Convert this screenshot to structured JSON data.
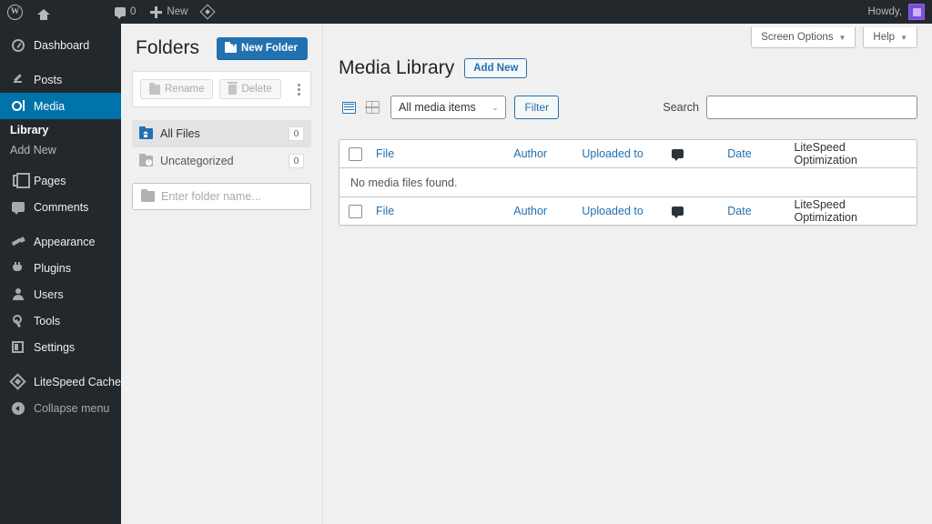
{
  "adminbar": {
    "wp_logo": "wordpress-logo",
    "site_home": "site-home",
    "comments_count": "0",
    "new_label": "New",
    "litespeed": "litespeed-icon",
    "howdy": "Howdy,"
  },
  "sidebar": {
    "items": [
      {
        "label": "Dashboard",
        "icon": "dashboard-icon",
        "active": false
      },
      {
        "label": "Posts",
        "icon": "posts-pin-icon",
        "active": false
      },
      {
        "label": "Media",
        "icon": "media-icon",
        "active": true
      },
      {
        "label": "Pages",
        "icon": "pages-icon",
        "active": false
      },
      {
        "label": "Comments",
        "icon": "comments-icon",
        "active": false
      },
      {
        "label": "Appearance",
        "icon": "appearance-brush-icon",
        "active": false
      },
      {
        "label": "Plugins",
        "icon": "plugins-icon",
        "active": false
      },
      {
        "label": "Users",
        "icon": "users-icon",
        "active": false
      },
      {
        "label": "Tools",
        "icon": "tools-wrench-icon",
        "active": false
      },
      {
        "label": "Settings",
        "icon": "settings-icon",
        "active": false
      },
      {
        "label": "LiteSpeed Cache",
        "icon": "litespeed-icon",
        "active": false
      },
      {
        "label": "Collapse menu",
        "icon": "collapse-icon",
        "active": false
      }
    ],
    "media_submenu": [
      {
        "label": "Library",
        "current": true
      },
      {
        "label": "Add New",
        "current": false
      }
    ]
  },
  "folders": {
    "title": "Folders",
    "new_folder_label": "New Folder",
    "rename_label": "Rename",
    "delete_label": "Delete",
    "more_menu": "more-options-icon",
    "list": [
      {
        "name": "All Files",
        "count": "0",
        "selected": true
      },
      {
        "name": "Uncategorized",
        "count": "0",
        "selected": false
      }
    ],
    "search_placeholder": "Enter folder name...",
    "search_value": ""
  },
  "screen_meta": {
    "screen_options": "Screen Options",
    "help": "Help"
  },
  "main": {
    "page_title": "Media Library",
    "add_new_label": "Add New",
    "view_list": "list-view-icon",
    "view_grid": "grid-view-icon",
    "media_filter_selected": "All media items",
    "filter_label": "Filter",
    "search_label": "Search",
    "search_value": "",
    "search_placeholder": "",
    "table": {
      "columns": {
        "file": "File",
        "author": "Author",
        "uploaded_to": "Uploaded to",
        "comments": "comments-icon",
        "date": "Date",
        "litespeed": "LiteSpeed Optimization"
      },
      "empty_message": "No media files found."
    }
  },
  "colors": {
    "admin_bar": "#23282d",
    "sidebar": "#23282d",
    "active_menu": "#0073aa",
    "primary_button": "#2271b1",
    "link": "#2271b1",
    "page_bg": "#f0f0f1",
    "avatar": "#7b4ddb"
  }
}
